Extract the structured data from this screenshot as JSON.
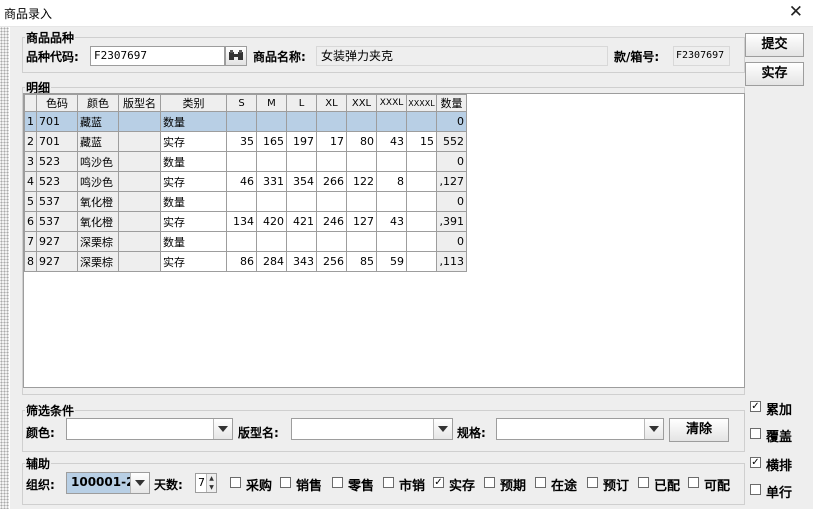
{
  "window": {
    "title": "商品录入"
  },
  "variety": {
    "legend": "商品品种",
    "code_label": "品种代码:",
    "code_value": "F2307697",
    "name_label": "商品名称:",
    "name_value": "女装弹力夹克",
    "style_label": "款/箱号:",
    "style_value": "F2307697"
  },
  "actions": {
    "submit": "提交",
    "stock": "实存",
    "clear": "清除"
  },
  "detail": {
    "legend": "明细",
    "columns": [
      "色码",
      "颜色",
      "版型名",
      "类别",
      "S",
      "M",
      "L",
      "XL",
      "XXL",
      "XXXL",
      "XXXXL",
      "数量"
    ],
    "rows": [
      {
        "no": "1",
        "code": "701",
        "color": "藏蓝",
        "pattern": "",
        "type": "数量",
        "S": "",
        "M": "",
        "L": "",
        "XL": "",
        "XXL": "",
        "XXXL": "",
        "XXXXL": "",
        "qty": "0",
        "selected": true
      },
      {
        "no": "2",
        "code": "701",
        "color": "藏蓝",
        "pattern": "",
        "type": "实存",
        "S": "35",
        "M": "165",
        "L": "197",
        "XL": "17",
        "XXL": "80",
        "XXXL": "43",
        "XXXXL": "15",
        "qty": "552",
        "selected": false
      },
      {
        "no": "3",
        "code": "523",
        "color": "鸣沙色",
        "pattern": "",
        "type": "数量",
        "S": "",
        "M": "",
        "L": "",
        "XL": "",
        "XXL": "",
        "XXXL": "",
        "XXXXL": "",
        "qty": "0",
        "selected": false
      },
      {
        "no": "4",
        "code": "523",
        "color": "鸣沙色",
        "pattern": "",
        "type": "实存",
        "S": "46",
        "M": "331",
        "L": "354",
        "XL": "266",
        "XXL": "122",
        "XXXL": "8",
        "XXXXL": "",
        "qty": ",127",
        "selected": false
      },
      {
        "no": "5",
        "code": "537",
        "color": "氧化橙",
        "pattern": "",
        "type": "数量",
        "S": "",
        "M": "",
        "L": "",
        "XL": "",
        "XXL": "",
        "XXXL": "",
        "XXXXL": "",
        "qty": "0",
        "selected": false
      },
      {
        "no": "6",
        "code": "537",
        "color": "氧化橙",
        "pattern": "",
        "type": "实存",
        "S": "134",
        "M": "420",
        "L": "421",
        "XL": "246",
        "XXL": "127",
        "XXXL": "43",
        "XXXXL": "",
        "qty": ",391",
        "selected": false
      },
      {
        "no": "7",
        "code": "927",
        "color": "深栗棕",
        "pattern": "",
        "type": "数量",
        "S": "",
        "M": "",
        "L": "",
        "XL": "",
        "XXL": "",
        "XXXL": "",
        "XXXXL": "",
        "qty": "0",
        "selected": false
      },
      {
        "no": "8",
        "code": "927",
        "color": "深栗棕",
        "pattern": "",
        "type": "实存",
        "S": "86",
        "M": "284",
        "L": "343",
        "XL": "256",
        "XXL": "85",
        "XXXL": "59",
        "XXXXL": "",
        "qty": ",113",
        "selected": false
      }
    ]
  },
  "options_right": [
    {
      "label": "累加",
      "checked": true
    },
    {
      "label": "覆盖",
      "checked": false
    },
    {
      "label": "横排",
      "checked": true
    },
    {
      "label": "单行",
      "checked": false
    }
  ],
  "filter": {
    "legend": "筛选条件",
    "color_label": "颜色:",
    "color_value": "",
    "pattern_label": "版型名:",
    "pattern_value": "",
    "spec_label": "规格:",
    "spec_value": ""
  },
  "assist": {
    "legend": "辅助",
    "org_label": "组织:",
    "org_value": "100001-2",
    "days_label": "天数:",
    "days_value": "7",
    "checks": [
      {
        "label": "采购",
        "checked": false
      },
      {
        "label": "销售",
        "checked": false
      },
      {
        "label": "零售",
        "checked": false
      },
      {
        "label": "市销",
        "checked": false
      },
      {
        "label": "实存",
        "checked": true
      },
      {
        "label": "预期",
        "checked": false
      },
      {
        "label": "在途",
        "checked": false
      },
      {
        "label": "预订",
        "checked": false
      },
      {
        "label": "已配",
        "checked": false
      },
      {
        "label": "可配",
        "checked": false
      }
    ]
  }
}
